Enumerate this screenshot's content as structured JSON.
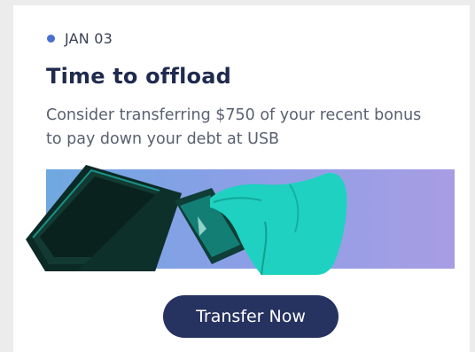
{
  "card": {
    "date": "JAN 03",
    "title": "Time to offload",
    "description": "Consider transferring $750 of your recent bonus to pay down your debt at USB",
    "button_label": "Transfer Now"
  },
  "colors": {
    "dot": "#4a6fd0",
    "title": "#1f2a4e",
    "button": "#263260",
    "banner_start": "#6fa8e0",
    "banner_end": "#a89de4",
    "hand_tint": "#1fd1c0"
  },
  "image": {
    "subject": "hand-holding-card-wallet-icon"
  }
}
